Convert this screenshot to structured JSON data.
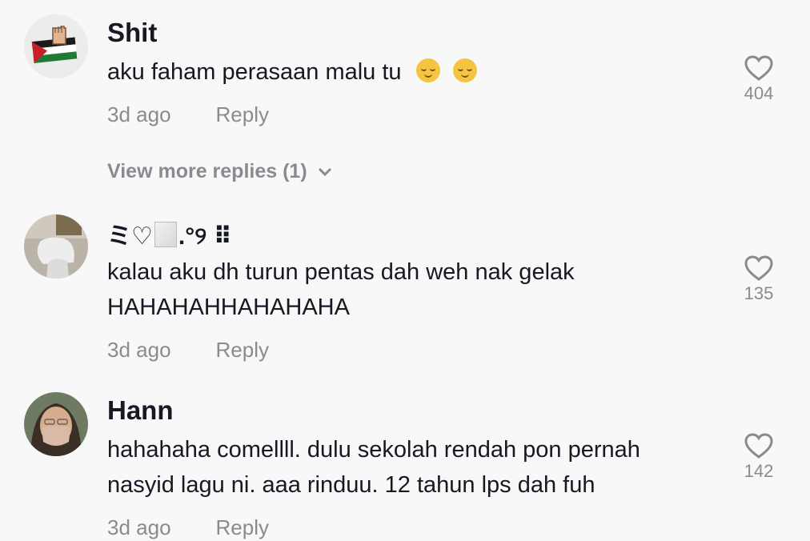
{
  "comments": [
    {
      "username": "Shit",
      "text": "aku faham perasaan malu tu",
      "emojis": [
        "relieved-face-emoji",
        "relieved-face-emoji"
      ],
      "time": "3d ago",
      "reply_label": "Reply",
      "likes": "404",
      "view_more": "View more replies (1)"
    },
    {
      "username_parts": [
        "ミ♡",
        ".°୨ ⠿"
      ],
      "text_line1": "kalau aku dh turun pentas dah weh nak gelak",
      "text_line2": "HAHAHAHHAHAHAHA",
      "time": "3d ago",
      "reply_label": "Reply",
      "likes": "135"
    },
    {
      "username": "Hann",
      "text_line1": "hahahaha comellll. dulu sekolah rendah pon pernah",
      "text_line2": "nasyid lagu ni. aaa rinduu. 12 tahun lps dah fuh",
      "time": "3d ago",
      "reply_label": "Reply",
      "likes": "142"
    }
  ],
  "icons": {
    "like": "heart-outline-icon",
    "expand": "chevron-down-icon"
  },
  "colors": {
    "text": "#161823",
    "muted": "#8a8b91",
    "background": "#f8f8f8"
  }
}
